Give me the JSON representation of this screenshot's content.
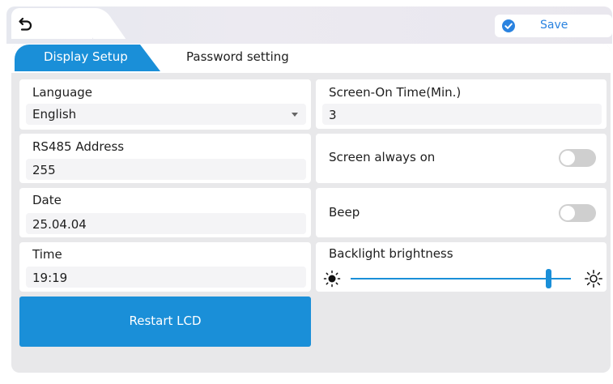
{
  "header": {
    "back_icon": "back-arrow-icon",
    "save_icon": "check-circle-icon",
    "save_label": "Save"
  },
  "tabs": [
    {
      "label": "Display Setup",
      "active": true
    },
    {
      "label": "Password setting",
      "active": false
    }
  ],
  "left": {
    "language": {
      "label": "Language",
      "value": "English"
    },
    "rs485": {
      "label": "RS485 Address",
      "value": "255"
    },
    "date": {
      "label": "Date",
      "value": "25.04.04"
    },
    "time": {
      "label": "Time",
      "value": "19:19"
    },
    "restart_label": "Restart LCD"
  },
  "right": {
    "screen_on_time": {
      "label": "Screen-On Time(Min.)",
      "value": "3"
    },
    "screen_always_on": {
      "label": "Screen always on",
      "on": false
    },
    "beep": {
      "label": "Beep",
      "on": false
    },
    "backlight": {
      "label": "Backlight brightness",
      "level": 0.9,
      "min_icon": "sun-dim-icon",
      "max_icon": "sun-bright-icon"
    }
  },
  "colors": {
    "accent": "#1a8fd8",
    "save_text": "#2a83e0",
    "panel_bg": "#e8e8ea",
    "toggle_off": "#cfcfcf"
  }
}
